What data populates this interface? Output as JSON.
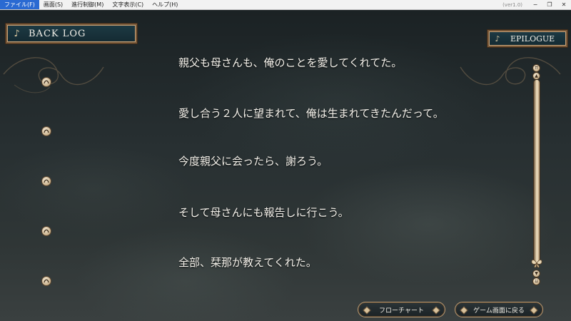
{
  "menubar": {
    "items": [
      "ファイル(F)",
      "画面(S)",
      "進行制御(M)",
      "文字表示(C)",
      "ヘルプ(H)"
    ],
    "version": "(ver1.0)",
    "controls": {
      "minimize": "−",
      "restore": "❐",
      "close": "✕"
    }
  },
  "header": {
    "title": "BACK LOG",
    "chapter": "EPILOGUE"
  },
  "log": {
    "lines": [
      "親父も母さんも、俺のことを愛してくれてた。",
      "愛し合う２人に望まれて、俺は生まれてきたんだって。",
      "今度親父に会ったら、謝ろう。",
      "そして母さんにも報告しに行こう。",
      "全部、栞那が教えてくれた。"
    ]
  },
  "scroll": {
    "top": "⇈",
    "up": "▲",
    "down": "▼",
    "bottom": "⇊"
  },
  "buttons": {
    "flowchart": "フローチャート",
    "return": "ゲーム画面に戻る"
  },
  "icons": {
    "voice": "voice-replay-icon",
    "note": "music-note-icon",
    "thumb": "butterfly-icon"
  },
  "colors": {
    "plaque": "#1d3a44",
    "border_gold": "#b89a74",
    "menu_active": "#2a6ad2"
  }
}
